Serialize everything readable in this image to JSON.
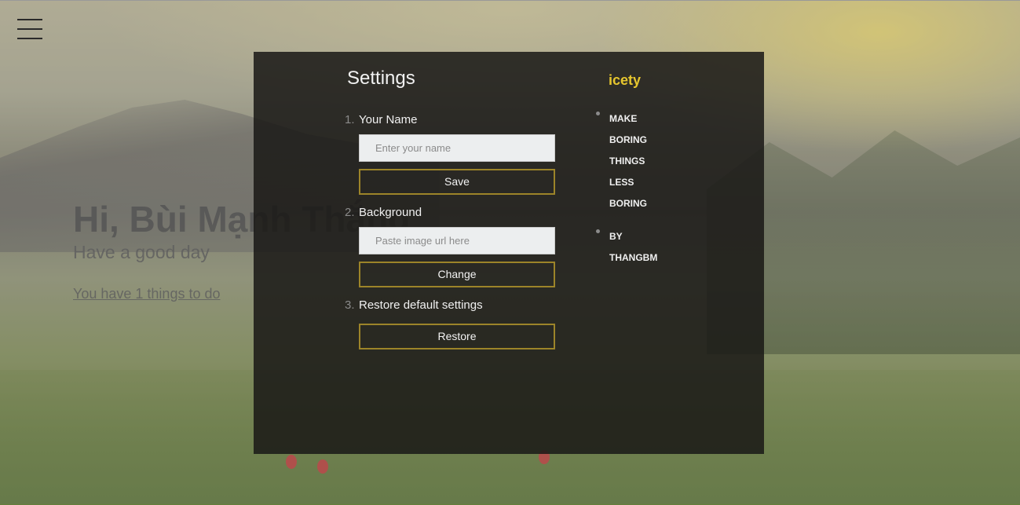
{
  "background": {
    "description_icon": "mountain-landscape-background"
  },
  "menu": {
    "icon": "hamburger-menu-icon"
  },
  "home": {
    "greeting": "Hi, Bùi Mạnh Thắng",
    "subtitle": "Have a good day",
    "todo_link": "You have 1 things to do"
  },
  "settings": {
    "title": "Settings",
    "steps": [
      {
        "number": "1.",
        "label": "Your Name",
        "input_placeholder": "Enter your name",
        "button_label": "Save"
      },
      {
        "number": "2.",
        "label": "Background",
        "input_placeholder": "Paste image url here",
        "button_label": "Change"
      },
      {
        "number": "3.",
        "label": "Restore default settings",
        "button_label": "Restore"
      }
    ]
  },
  "about": {
    "brand": "icety",
    "items": [
      {
        "words": [
          "MAKE",
          "BORING",
          "THINGS",
          "LESS",
          "BORING"
        ]
      },
      {
        "words": [
          "BY",
          "THANGBM"
        ]
      }
    ]
  },
  "colors": {
    "accent_gold": "#e6c62e",
    "button_border": "#9c8429",
    "panel_bg": "#1a1816"
  }
}
